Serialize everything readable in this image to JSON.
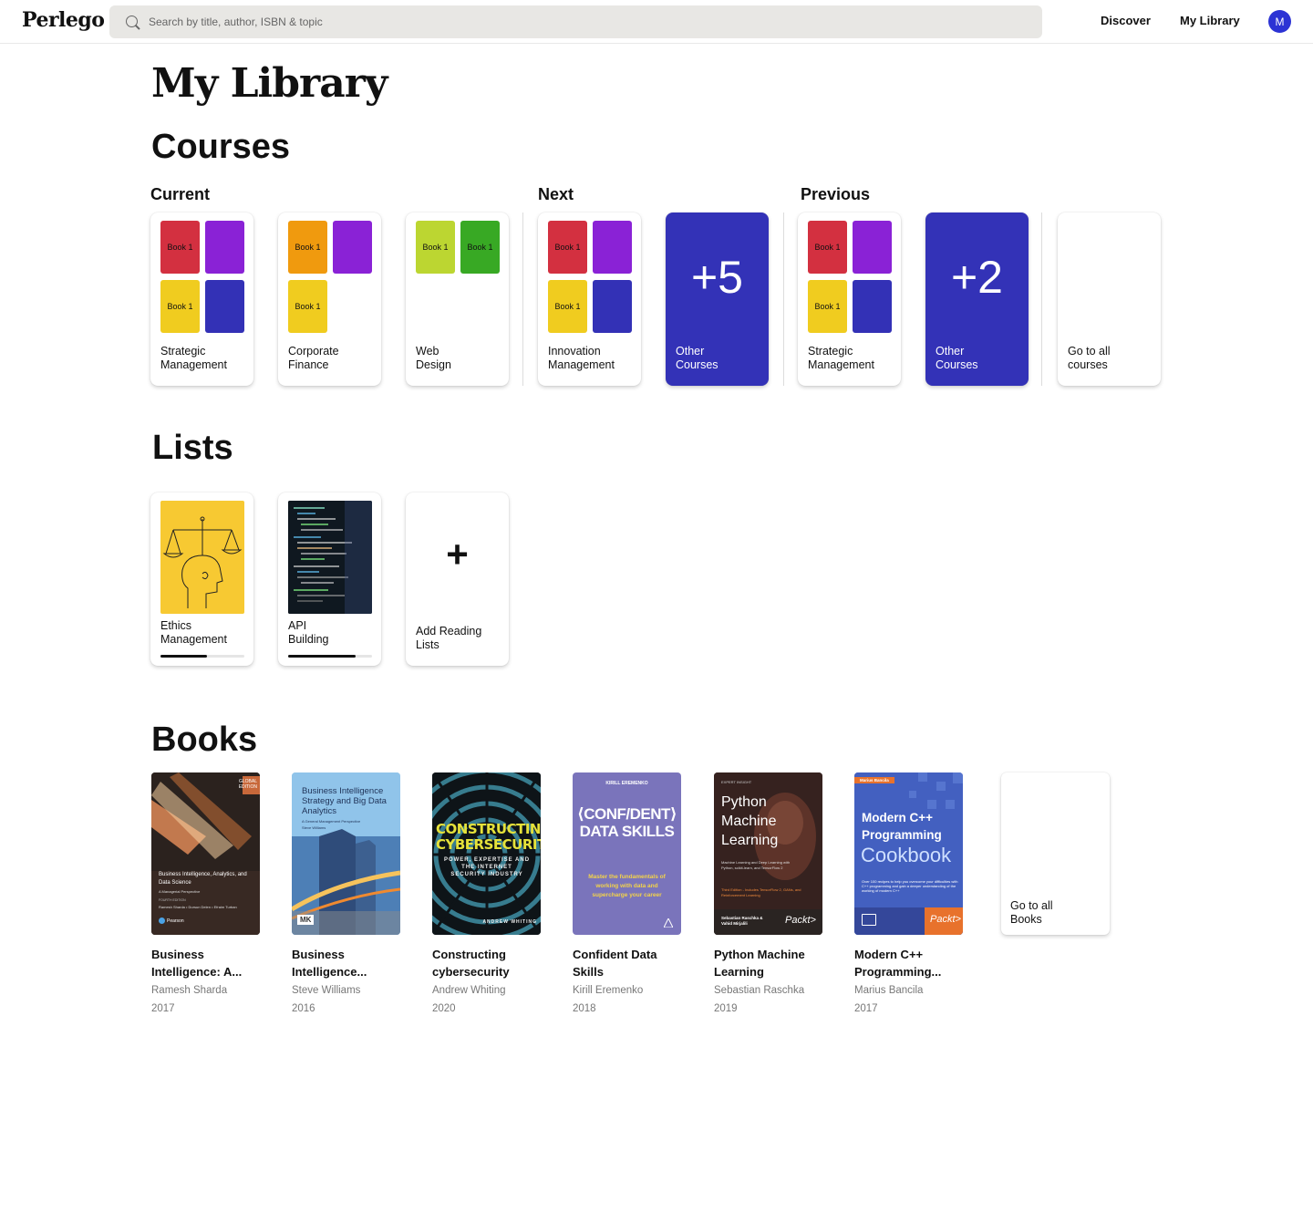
{
  "header": {
    "logo": "Perlego",
    "search_placeholder": "Search by title, author, ISBN & topic",
    "nav": [
      "Discover",
      "My Library"
    ],
    "avatar_initial": "M"
  },
  "page_title": "My Library",
  "courses": {
    "title": "Courses",
    "groups": [
      "Current",
      "Next",
      "Previous"
    ],
    "cards": [
      {
        "label": "Strategic\nManagement",
        "tiles": [
          {
            "color": "#d33040",
            "text": "Book 1"
          },
          {
            "color": "#8a22d6",
            "text": ""
          },
          {
            "color": "#f0cc1f",
            "text": "Book 1"
          },
          {
            "color": "#3331b6",
            "text": ""
          }
        ]
      },
      {
        "label": "Corporate\nFinance",
        "tiles": [
          {
            "color": "#f09a0e",
            "text": "Book 1"
          },
          {
            "color": "#8a22d6",
            "text": ""
          },
          {
            "color": "#f0cc1f",
            "text": "Book 1"
          }
        ]
      },
      {
        "label": "Web\nDesign",
        "tiles": [
          {
            "color": "#bcd631",
            "text": "Book 1"
          },
          {
            "color": "#38a924",
            "text": "Book 1"
          }
        ]
      },
      {
        "label": "Innovation\nManagement",
        "tiles": [
          {
            "color": "#d33040",
            "text": "Book 1"
          },
          {
            "color": "#8a22d6",
            "text": ""
          },
          {
            "color": "#f0cc1f",
            "text": "Book 1"
          },
          {
            "color": "#3331b6",
            "text": ""
          }
        ]
      },
      {
        "label": "Other\nCourses",
        "count": "+5"
      },
      {
        "label": "Strategic\nManagement",
        "tiles": [
          {
            "color": "#d33040",
            "text": "Book 1"
          },
          {
            "color": "#8a22d6",
            "text": ""
          },
          {
            "color": "#f0cc1f",
            "text": "Book 1"
          },
          {
            "color": "#3331b6",
            "text": ""
          }
        ]
      },
      {
        "label": "Other\nCourses",
        "count": "+2"
      },
      {
        "label": "Go to all\ncourses"
      }
    ]
  },
  "lists": {
    "title": "Lists",
    "items": [
      {
        "label": "Ethics\nManagement",
        "progress": 0.55
      },
      {
        "label": "API\nBuilding",
        "progress": 0.8
      },
      {
        "label": "Add Reading\nLists",
        "icon": "+"
      }
    ]
  },
  "books": {
    "title": "Books",
    "items": [
      {
        "title": "Business Intelligence: A...",
        "author": "Ramesh Sharda",
        "year": "2017",
        "cover": {
          "badge": "GLOBAL EDITION",
          "text": "Business Intelligence, Analytics, and Data Science",
          "subtitle": "A Managerial Perspective",
          "edition": "FOURTH EDITION",
          "authors": "Ramesh Sharda • Dursun Delen • Efraim Turban",
          "publisher": "Pearson"
        }
      },
      {
        "title": "Business Intelligence...",
        "author": "Steve Williams",
        "year": "2016",
        "cover": {
          "text": "Business Intelligence Strategy and Big Data Analytics",
          "subtitle": "A General Management Perspective",
          "author": "Steve Williams",
          "publisher": "MK"
        }
      },
      {
        "title": "Constructing cybersecurity",
        "author": "Andrew Whiting",
        "year": "2020",
        "cover": {
          "text": "CONSTRUCTING CYBERSECURITY",
          "subtitle": "POWER, EXPERTISE AND THE INTERNET SECURITY INDUSTRY",
          "author": "ANDREW WHITING"
        }
      },
      {
        "title": "Confident Data Skills",
        "author": "Kirill Eremenko",
        "year": "2018",
        "cover": {
          "author": "KIRILL EREMENKO",
          "text": "⟨CONF/DENT⟩ DATA SKILLS",
          "subtitle": "Master the fundamentals of working with data and supercharge your career"
        }
      },
      {
        "title": "Python Machine Learning",
        "author": "Sebastian Raschka",
        "year": "2019",
        "cover": {
          "badge": "EXPERT INSIGHT",
          "text": "Python Machine Learning",
          "subtitle": "Machine Learning and Deep Learning with Python, scikit-learn, and TensorFlow 2",
          "edition": "Third Edition - Includes TensorFlow 2, GANs, and Reinforcement Learning",
          "authors": "Sebastian Raschka & Vahid Mirjalili",
          "publisher": "Packt>"
        }
      },
      {
        "title": "Modern C++ Programming...",
        "author": "Marius Bancila",
        "year": "2017",
        "cover": {
          "badge": "Marius Bancila",
          "text": "Modern C++ Programming",
          "subtitle": "Cookbook",
          "edition": "Over 100 recipes to help you overcome your difficulties with C++ programming and gain a deeper understanding of the working of modern C++",
          "publisher": "Packt>"
        }
      }
    ],
    "go_all": "Go to all\nBooks"
  }
}
